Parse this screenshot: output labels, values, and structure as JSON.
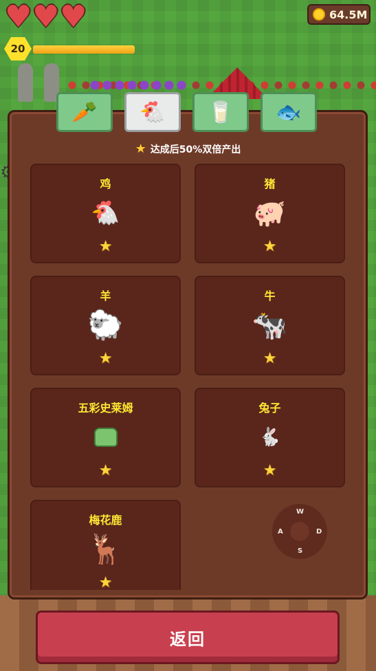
{
  "hud": {
    "hearts": 3,
    "coins": "64.5M",
    "level": "20",
    "xp_progress": 1.0
  },
  "tabs": [
    {
      "name": "crops",
      "icon": "🥕"
    },
    {
      "name": "animals",
      "icon": "🐔"
    },
    {
      "name": "products",
      "icon": "🥛"
    },
    {
      "name": "fish",
      "icon": "🐟"
    }
  ],
  "active_tab": 1,
  "bonus_text": "达成后50%双倍产出",
  "animals": [
    {
      "name": "鸡",
      "icon": "🐔"
    },
    {
      "name": "猪",
      "icon": "🐖"
    },
    {
      "name": "羊",
      "icon": "🐑"
    },
    {
      "name": "牛",
      "icon": "🐄"
    },
    {
      "name": "五彩史莱姆",
      "icon": "🟩"
    },
    {
      "name": "兔子",
      "icon": "🐇"
    },
    {
      "name": "梅花鹿",
      "icon": "🦌"
    }
  ],
  "dpad": {
    "up": "W",
    "left": "A",
    "right": "D",
    "down": "S"
  },
  "back_button": "返回",
  "colors": {
    "panel": "#6e3a28",
    "card": "#5a261c",
    "title": "#ffe933",
    "button": "#c8404f"
  }
}
